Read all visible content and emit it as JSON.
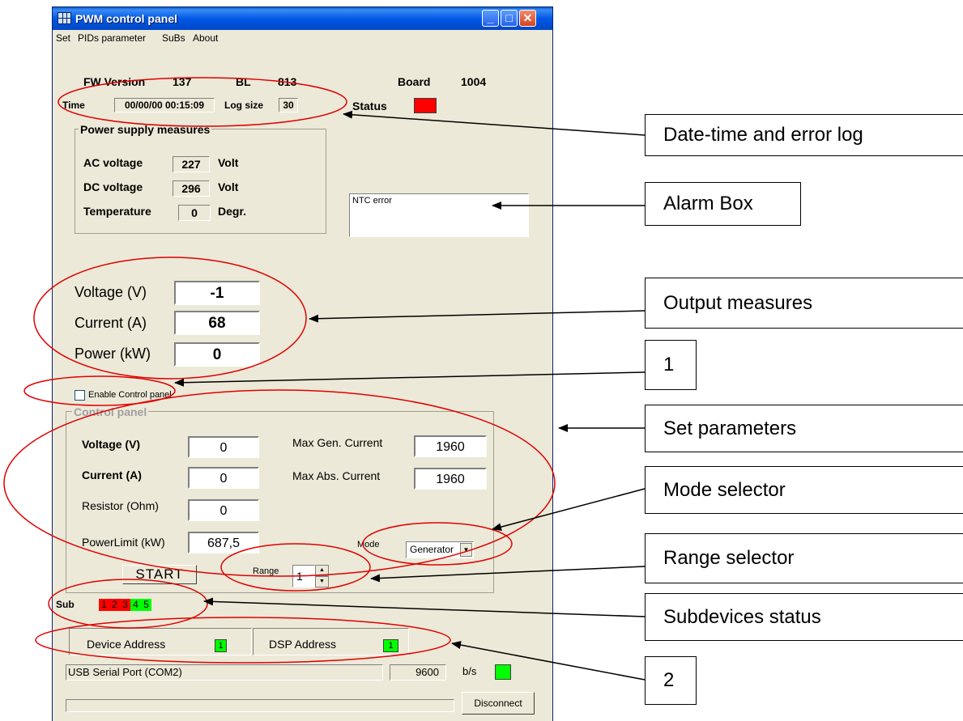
{
  "window": {
    "title": "PWM control panel",
    "menu": [
      "Set",
      "PIDs parameter",
      "SuBs",
      "About"
    ]
  },
  "info": {
    "fw_label": "FW Version",
    "fw_value": "137",
    "bl_label": "BL",
    "bl_value": "813",
    "board_label": "Board",
    "board_value": "1004",
    "time_label": "Time",
    "time_value": "00/00/00 00:15:09",
    "logsize_label": "Log size",
    "logsize_value": "30",
    "status_label": "Status",
    "status_color": "#ff0000"
  },
  "power_supply": {
    "title": "Power supply measures",
    "ac_label": "AC voltage",
    "ac_value": "227",
    "ac_unit": "Volt",
    "dc_label": "DC voltage",
    "dc_value": "296",
    "dc_unit": "Volt",
    "temp_label": "Temperature",
    "temp_value": "0",
    "temp_unit": "Degr."
  },
  "alarm": {
    "text": "NTC error"
  },
  "output": {
    "voltage_label": "Voltage (V)",
    "voltage_value": "-1",
    "current_label": "Current (A)",
    "current_value": "68",
    "power_label": "Power (kW)",
    "power_value": "0"
  },
  "enable_checkbox": {
    "label": "Enable Control panel",
    "checked": false
  },
  "control_panel": {
    "title": "Control panel",
    "voltage_label": "Voltage (V)",
    "voltage_value": "0",
    "current_label": "Current (A)",
    "current_value": "0",
    "resistor_label": "Resistor (Ohm)",
    "resistor_value": "0",
    "powerlimit_label": "PowerLimit (kW)",
    "powerlimit_value": "687,5",
    "maxgen_label": "Max Gen. Current",
    "maxgen_value": "1960",
    "maxabs_label": "Max Abs. Current",
    "maxabs_value": "1960",
    "mode_label": "Mode",
    "mode_value": "Generator",
    "range_label": "Range",
    "range_value": "1",
    "start_label": "START"
  },
  "subdevices": {
    "label": "Sub",
    "items": [
      {
        "n": "1",
        "color": "#ff0000"
      },
      {
        "n": "2",
        "color": "#ff0000"
      },
      {
        "n": "3",
        "color": "#ff0000"
      },
      {
        "n": "4",
        "color": "#00ff00"
      },
      {
        "n": "5",
        "color": "#00ff00"
      }
    ]
  },
  "addresses": {
    "device_label": "Device Address",
    "device_value": "1",
    "dsp_label": "DSP Address",
    "dsp_value": "1",
    "led_color": "#00ff00"
  },
  "connection": {
    "port": "USB Serial Port (COM2)",
    "baud": "9600",
    "baud_unit": "b/s",
    "led_color": "#00ff00",
    "disconnect_label": "Disconnect"
  },
  "callouts": {
    "datetime": "Date-time and error log",
    "alarm": "Alarm Box",
    "output": "Output measures",
    "one": "1",
    "set_params": "Set parameters",
    "mode": "Mode selector",
    "range": "Range selector",
    "subdevices": "Subdevices status",
    "two": "2"
  },
  "colors": {
    "annotation": "#e00000",
    "panel_bg": "#ece9d8",
    "titlebar": "#0058e6"
  }
}
